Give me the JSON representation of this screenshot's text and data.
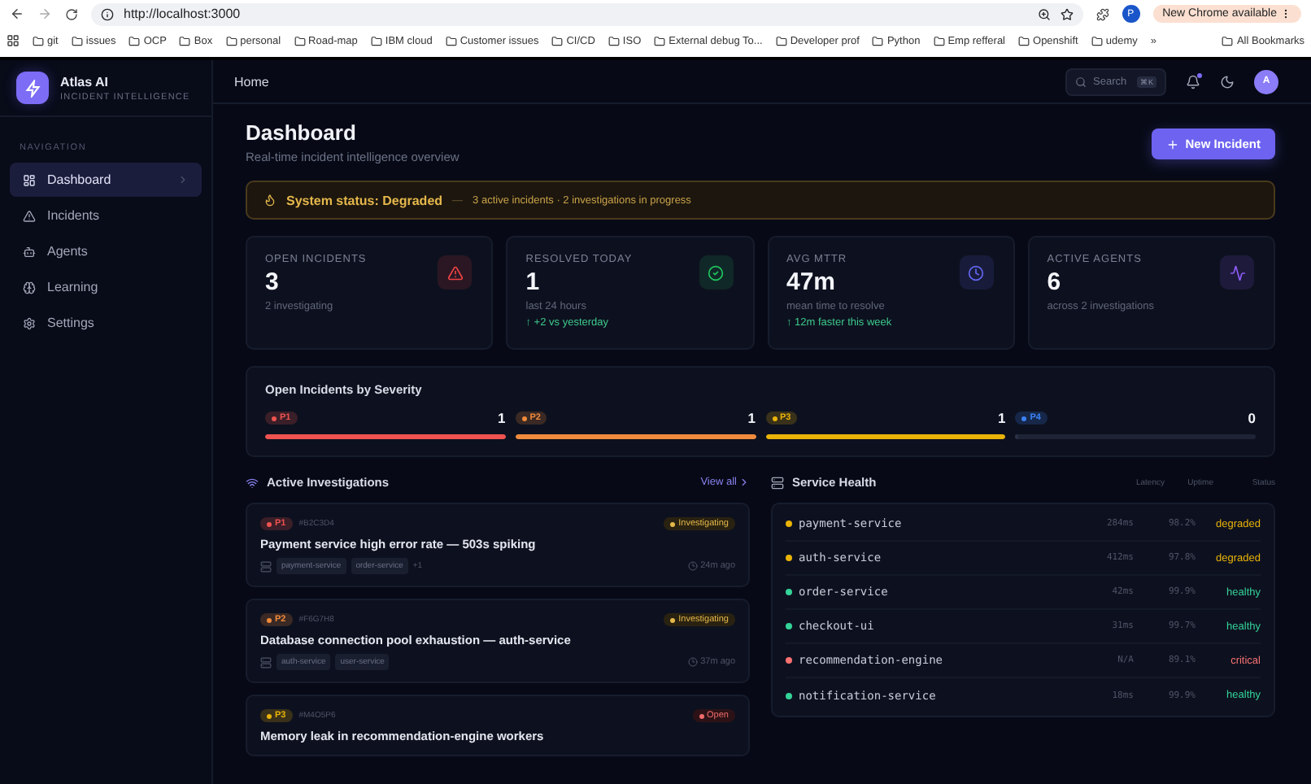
{
  "browser": {
    "url": "http://localhost:3000",
    "update_label": "New Chrome available",
    "profile_initial": "P",
    "bookmarks": [
      "git",
      "issues",
      "OCP",
      "Box",
      "personal",
      "Road-map",
      "IBM cloud",
      "Customer issues",
      "CI/CD",
      "ISO",
      "External debug To...",
      "Developer prof",
      "Python",
      "Emp refferal",
      "Openshift",
      "udemy"
    ],
    "more_bookmarks": "»",
    "all_bookmarks": "All Bookmarks"
  },
  "sidebar": {
    "brand": "Atlas AI",
    "tagline": "INCIDENT INTELLIGENCE",
    "section": "NAVIGATION",
    "items": [
      {
        "label": "Dashboard",
        "selected": true
      },
      {
        "label": "Incidents",
        "selected": false
      },
      {
        "label": "Agents",
        "selected": false
      },
      {
        "label": "Learning",
        "selected": false
      },
      {
        "label": "Settings",
        "selected": false
      }
    ]
  },
  "header": {
    "breadcrumb": "Home",
    "search_placeholder": "Search",
    "shortcut": "⌘K",
    "notifications_unread": true,
    "avatar_initial": "A"
  },
  "page": {
    "title": "Dashboard",
    "subtitle": "Real-time incident intelligence overview",
    "new_button": "New Incident"
  },
  "status_banner": {
    "label": "System status: Degraded",
    "dash": "—",
    "detail": "3 active incidents · 2 investigations in progress"
  },
  "stats": [
    {
      "label": "OPEN INCIDENTS",
      "value": "3",
      "note": "2 investigating",
      "color": "#ef4444"
    },
    {
      "label": "RESOLVED TODAY",
      "value": "1",
      "note": "last 24 hours",
      "trend": "↑ +2 vs yesterday",
      "color": "#22c55e"
    },
    {
      "label": "AVG MTTR",
      "value": "47m",
      "note": "mean time to resolve",
      "trend": "↑ 12m faster this week",
      "color": "#6366f1"
    },
    {
      "label": "ACTIVE AGENTS",
      "value": "6",
      "note": "across 2 investigations",
      "color": "#8b5cf6"
    }
  ],
  "severity": {
    "title": "Open Incidents by Severity",
    "items": [
      {
        "label": "P1",
        "count": "1",
        "level": 1,
        "color": "#ef5350"
      },
      {
        "label": "P2",
        "count": "1",
        "level": 1,
        "color": "#f08a3c"
      },
      {
        "label": "P3",
        "count": "1",
        "level": 1,
        "color": "#eab308"
      },
      {
        "label": "P4",
        "count": "0",
        "level": 0,
        "color": "#3b82f6"
      }
    ]
  },
  "investigations": {
    "title": "Active Investigations",
    "view_all": "View all",
    "cards": [
      {
        "severity": "P1",
        "color": "#ef5350",
        "id": "#B2C3D4",
        "status": "Investigating",
        "kind": "investigating",
        "title": "Payment service high error rate — 503s spiking",
        "services": [
          "payment-service",
          "order-service"
        ],
        "more": "+1",
        "age": "24m ago"
      },
      {
        "severity": "P2",
        "color": "#f08a3c",
        "id": "#F6G7H8",
        "status": "Investigating",
        "kind": "investigating",
        "title": "Database connection pool exhaustion — auth-service",
        "services": [
          "auth-service",
          "user-service"
        ],
        "age": "37m ago"
      },
      {
        "severity": "P3",
        "color": "#eab308",
        "id": "#M4O5P6",
        "status": "Open",
        "kind": "open",
        "title": "Memory leak in recommendation-engine workers"
      }
    ]
  },
  "service_health": {
    "title": "Service Health",
    "columns": [
      "Latency",
      "Uptime",
      "Status"
    ],
    "rows": [
      {
        "name": "payment-service",
        "latency": "284ms",
        "uptime": "98.2%",
        "status": "degraded",
        "color": "#eab308"
      },
      {
        "name": "auth-service",
        "latency": "412ms",
        "uptime": "97.8%",
        "status": "degraded",
        "color": "#eab308"
      },
      {
        "name": "order-service",
        "latency": "42ms",
        "uptime": "99.9%",
        "status": "healthy",
        "color": "#34d399"
      },
      {
        "name": "checkout-ui",
        "latency": "31ms",
        "uptime": "99.7%",
        "status": "healthy",
        "color": "#34d399"
      },
      {
        "name": "recommendation-engine",
        "latency": "N/A",
        "uptime": "89.1%",
        "status": "critical",
        "color": "#f87171"
      },
      {
        "name": "notification-service",
        "latency": "18ms",
        "uptime": "99.9%",
        "status": "healthy",
        "color": "#34d399"
      }
    ]
  }
}
